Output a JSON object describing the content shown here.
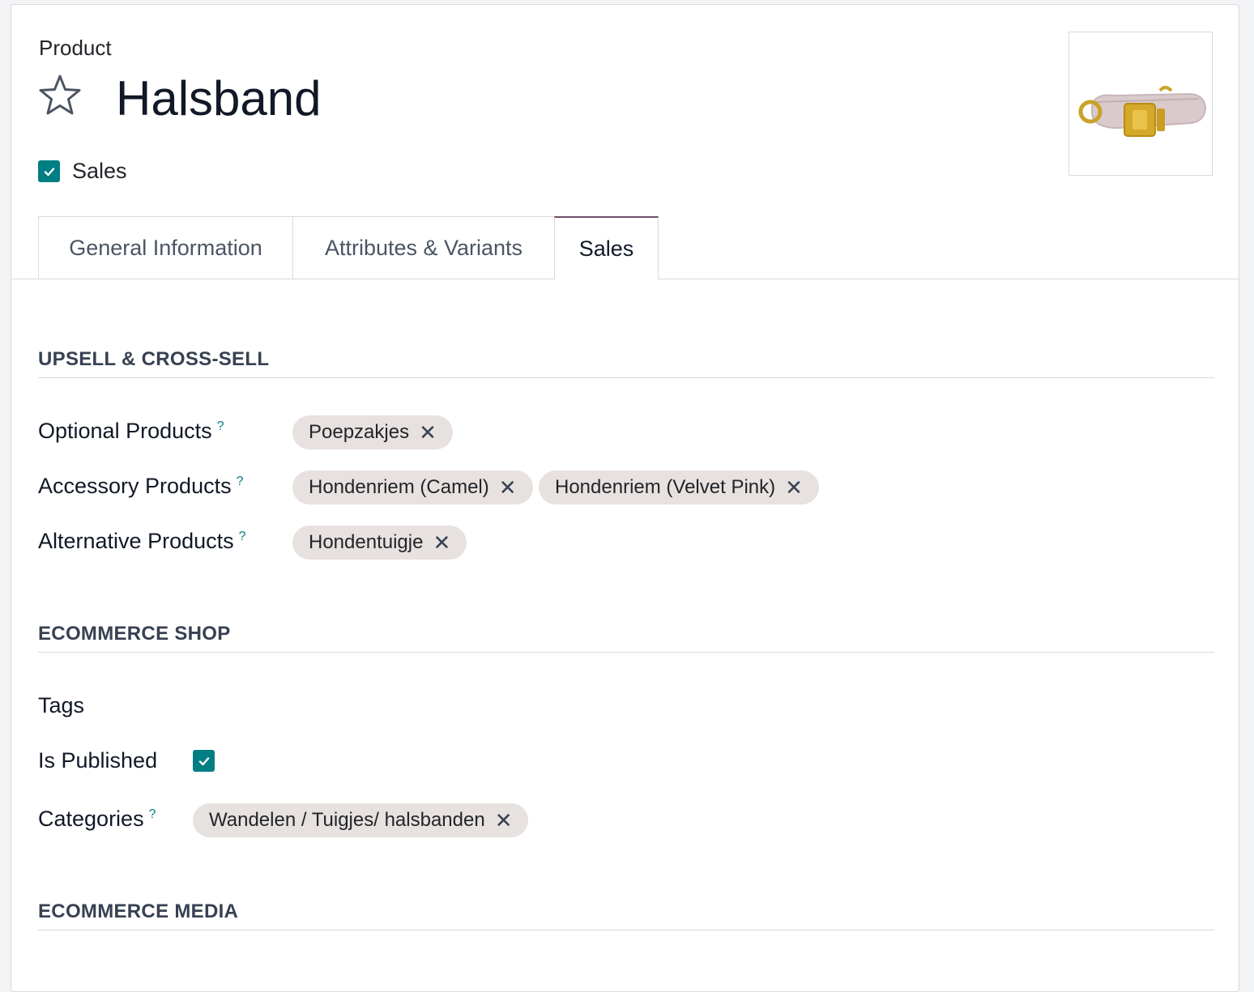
{
  "header": {
    "breadcrumb": "Product",
    "title": "Halsband",
    "sales_label": "Sales",
    "sales_checked": true
  },
  "tabs": [
    {
      "label": "General Information",
      "active": false
    },
    {
      "label": "Attributes & Variants",
      "active": false
    },
    {
      "label": "Sales",
      "active": true
    }
  ],
  "upsell": {
    "title": "UPSELL & CROSS-SELL",
    "optional_label": "Optional Products",
    "optional_tags": [
      "Poepzakjes"
    ],
    "accessory_label": "Accessory Products",
    "accessory_tags": [
      "Hondenriem (Camel)",
      "Hondenriem (Velvet Pink)"
    ],
    "alternative_label": "Alternative Products",
    "alternative_tags": [
      "Hondentuigje"
    ],
    "help_symbol": "?"
  },
  "ecommerce_shop": {
    "title": "ECOMMERCE SHOP",
    "tags_label": "Tags",
    "published_label": "Is Published",
    "published_checked": true,
    "categories_label": "Categories",
    "categories_tags": [
      "Wandelen / Tuigjes/ halsbanden"
    ]
  },
  "ecommerce_media": {
    "title": "ECOMMERCE MEDIA"
  },
  "colors": {
    "accent": "#017e84",
    "tab_active_border": "#714b67",
    "tag_bg": "#e7e1df"
  },
  "icons": {
    "favorite": "star-outline-icon",
    "remove": "close-x-icon",
    "check": "check-icon"
  }
}
